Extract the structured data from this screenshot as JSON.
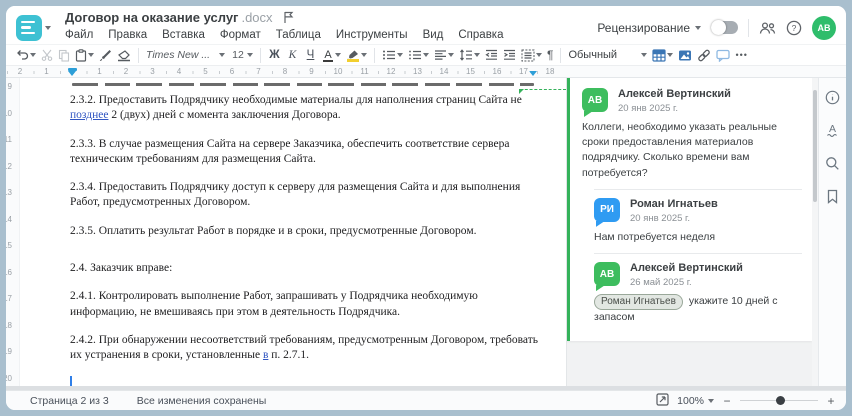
{
  "window": {
    "title": "Договор на оказание услуг",
    "title_ext": ".docx"
  },
  "menu": {
    "items": [
      "Файл",
      "Правка",
      "Вставка",
      "Формат",
      "Таблица",
      "Инструменты",
      "Вид",
      "Справка"
    ]
  },
  "topbar": {
    "review_label": "Рецензирование",
    "avatar_initials": "АВ"
  },
  "toolbar": {
    "font_name": "Times New ...",
    "font_size": "12",
    "bold_label": "Ж",
    "italic_label": "К",
    "underline_label": "Ч",
    "font_color_label": "А",
    "pilcrow": "¶",
    "style_name": "Обычный",
    "more_label": "•••"
  },
  "ruler": {
    "left_numbers": [
      "2",
      "1"
    ],
    "numbers": [
      "1",
      "2",
      "3",
      "4",
      "5",
      "6",
      "7",
      "8",
      "9",
      "10",
      "11",
      "12",
      "13",
      "14",
      "15",
      "16",
      "17",
      "18"
    ],
    "vertical_numbers": [
      "9",
      "10",
      "11",
      "12",
      "13",
      "14",
      "15",
      "16",
      "17",
      "18",
      "19",
      "20"
    ]
  },
  "document": {
    "paragraphs": [
      {
        "runs": [
          {
            "t": "2.3.2. Предоставить Подрядчику необходимые материалы для наполнения страниц Сайта не "
          },
          {
            "br": true
          },
          {
            "t": "позднее",
            "s": "ins"
          },
          {
            "t": " 2 (двух) дней с момента заключения Договора."
          }
        ]
      },
      {
        "runs": [
          {
            "t": "2.3.3. В случае размещения Сайта на сервере Заказчика, обеспечить соответствие сервера "
          },
          {
            "br": true
          },
          {
            "t": "техническим требованиям для размещения Сайта."
          }
        ]
      },
      {
        "runs": [
          {
            "t": "2.3.4. Предоставить Подрядчику доступ к серверу для размещения Сайта и для выполнения "
          },
          {
            "br": true
          },
          {
            "t": "Работ, предусмотренных Договором."
          }
        ]
      },
      {
        "runs": [
          {
            "t": "2.3.5. Оплатить результат Работ в порядке и в сроки, предусмотренные Договором."
          }
        ]
      },
      {
        "runs": [
          {
            "t": "2.4. Заказчик вправе:"
          }
        ],
        "spacing_before": true
      },
      {
        "runs": [
          {
            "t": "2.4.1. Контролировать выполнение Работ, запрашивать у Подрядчика необходимую "
          },
          {
            "br": true
          },
          {
            "t": "информацию, не вмешиваясь при этом в деятельность Подрядчика."
          }
        ]
      },
      {
        "runs": [
          {
            "t": "2.4.2. При обнаружении несоответствий требованиям, предусмотренным Договором, требовать "
          },
          {
            "br": true
          },
          {
            "t": "их устранения в сроки, установленные "
          },
          {
            "t": "в",
            "s": "ins"
          },
          {
            "t": " п. 2.7.1."
          }
        ]
      }
    ]
  },
  "comments": [
    {
      "initials": "АВ",
      "avatar_color": "#3dbd5e",
      "author": "Алексей Вертинский",
      "date": "20 янв 2025 г.",
      "text": "Коллеги, необходимо указать реальные сроки предоставления материалов подрядчику. Сколько времени вам потребуется?",
      "reply": false
    },
    {
      "initials": "РИ",
      "avatar_color": "#2f9bf2",
      "author": "Роман Игнатьев",
      "date": "20 янв 2025 г.",
      "text": "Нам потребуется неделя",
      "reply": true
    },
    {
      "initials": "АВ",
      "avatar_color": "#3dbd5e",
      "author": "Алексей Вертинский",
      "date": "26 май 2025 г.",
      "mention": "Роман Игнатьев",
      "text": " укажите 10 дней с запасом",
      "reply": true
    }
  ],
  "statusbar": {
    "page_label": "Страница 2 из 3",
    "saved_label": "Все изменения сохранены",
    "zoom_value": "100%",
    "zoom_out": "−",
    "zoom_in": "+"
  },
  "colors": {
    "accent_teal": "#3ec1d3",
    "comment_green": "#34b25a",
    "reply_blue": "#2f9bf2",
    "insert_blue": "#3156c2",
    "icon_blue": "#3b76b5"
  }
}
